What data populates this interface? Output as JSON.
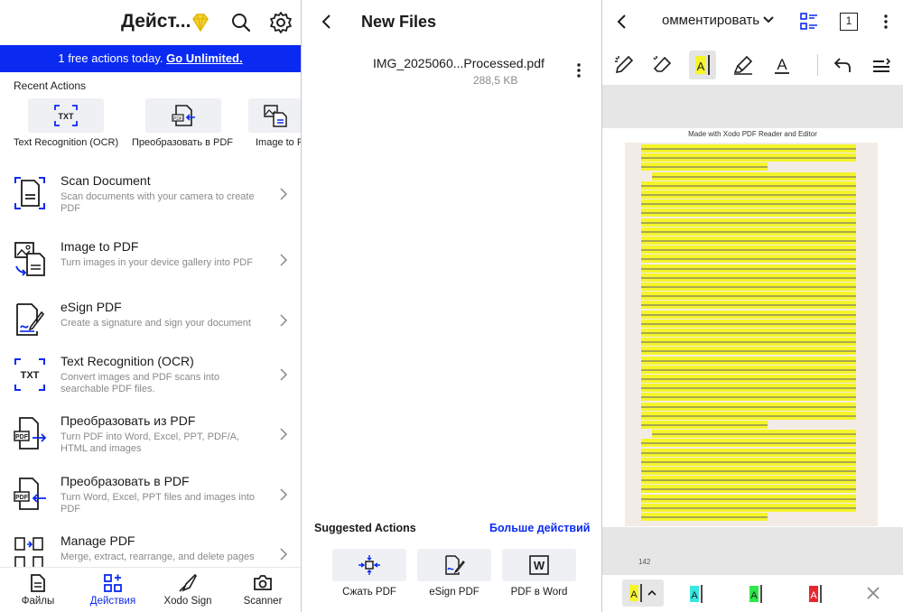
{
  "screen1": {
    "title": "Дейст...",
    "banner": {
      "text": "1 free actions today.",
      "link": "Go Unlimited."
    },
    "recent_label": "Recent Actions",
    "recent": [
      {
        "label": "Text Recognition (OCR)",
        "icon": "ocr-icon"
      },
      {
        "label": "Преобразовать в PDF",
        "icon": "convert-to-pdf-icon"
      },
      {
        "label": "Image to F",
        "icon": "image-to-pdf-icon"
      }
    ],
    "actions": [
      {
        "title": "Scan Document",
        "desc": "Scan documents with your camera to create PDF",
        "icon": "scan-document-icon"
      },
      {
        "title": "Image to PDF",
        "desc": "Turn images in your device gallery into PDF",
        "icon": "image-to-pdf-icon"
      },
      {
        "title": "eSign PDF",
        "desc": "Create a signature and sign your document",
        "icon": "esign-icon"
      },
      {
        "title": "Text Recognition (OCR)",
        "desc": "Convert images and PDF scans into searchable PDF files.",
        "icon": "ocr-icon"
      },
      {
        "title": "Преобразовать из PDF",
        "desc": "Turn PDF into Word, Excel, PPT, PDF/A, HTML and images",
        "icon": "convert-from-pdf-icon"
      },
      {
        "title": "Преобразовать в PDF",
        "desc": "Turn Word, Excel, PPT files and images into PDF",
        "icon": "convert-to-pdf-icon"
      },
      {
        "title": "Manage PDF",
        "desc": "Merge, extract, rearrange, and delete pages",
        "icon": "manage-pdf-icon"
      }
    ],
    "nav": [
      {
        "label": "Файлы",
        "icon": "files-icon",
        "active": false
      },
      {
        "label": "Действия",
        "icon": "actions-icon",
        "active": true
      },
      {
        "label": "Xodo Sign",
        "icon": "pen-nib-icon",
        "active": false
      },
      {
        "label": "Scanner",
        "icon": "camera-icon",
        "active": false
      }
    ],
    "accent": "#0a2af2"
  },
  "screen2": {
    "title": "New Files",
    "file": {
      "name": "IMG_2025060...Processed.pdf",
      "size": "288,5 KB"
    },
    "suggested_label": "Suggested Actions",
    "more_label": "Больше действий",
    "suggested": [
      {
        "label": "Сжать PDF",
        "icon": "compress-icon"
      },
      {
        "label": "eSign PDF",
        "icon": "esign-icon"
      },
      {
        "label": "PDF в Word",
        "icon": "word-icon"
      }
    ]
  },
  "screen3": {
    "mode": "омментировать",
    "page_badge": "1",
    "made_with": "Made with Xodo PDF Reader and Editor",
    "page_number": "142",
    "highlight_color": "#f5f52a",
    "swatches": [
      "#f5f52a",
      "#36e8e0",
      "#2ee84a",
      "#e8262e"
    ]
  }
}
